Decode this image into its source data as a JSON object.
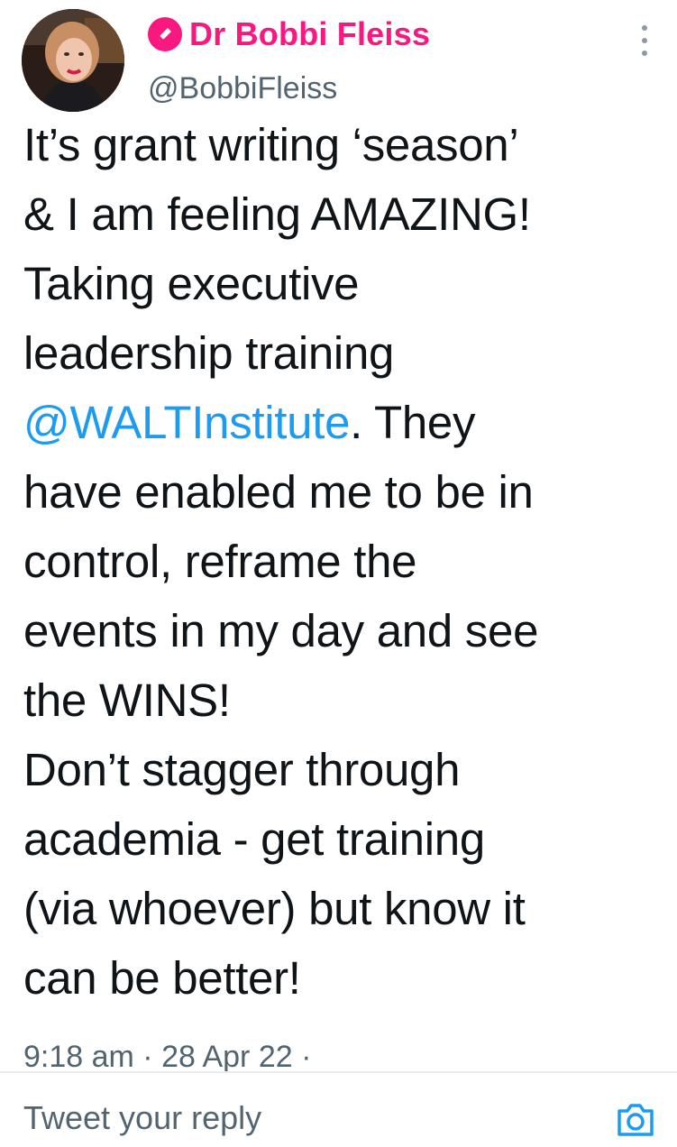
{
  "author": {
    "display_name": "Dr Bobbi Fleiss",
    "handle": "@BobbiFleiss",
    "badge_icon": "pencil-icon",
    "badge_color": "#f91880"
  },
  "tweet": {
    "lines": [
      "It’s grant writing ‘season’",
      "& I am feeling AMAZING!",
      "Taking executive",
      "leadership training",
      "",
      "have enabled me to be in",
      "control, reframe the",
      "events in my day and see",
      "the WINS!",
      "Don’t stagger through",
      "academia - get training",
      "(via whoever) but know it",
      "can be better!"
    ],
    "mention": "@WALTInstitute",
    "mention_after": ". They",
    "mention_color": "#1d9bf0"
  },
  "meta": {
    "time": "9:18 am",
    "separator": " · ",
    "date": "28 Apr 22",
    "trailing": " ·"
  },
  "reply": {
    "placeholder": "Tweet your reply",
    "camera_icon": "camera-icon"
  },
  "more_icon": "more-vertical-icon"
}
